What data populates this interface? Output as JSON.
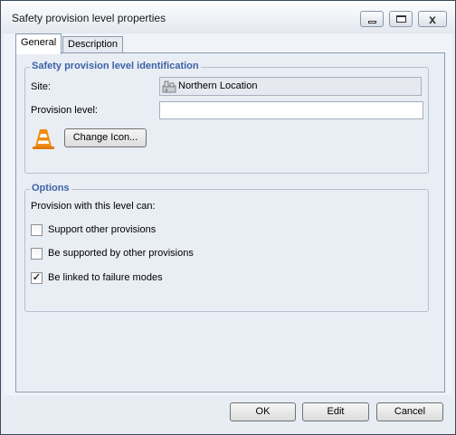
{
  "window": {
    "title": "Safety provision level properties",
    "controls": {
      "minimize": "minimize-icon",
      "maximize": "maximize-icon",
      "close": "close-icon",
      "close_glyph": "x"
    }
  },
  "tabs": [
    {
      "label": "General",
      "selected": true
    },
    {
      "label": "Description",
      "selected": false
    }
  ],
  "identification": {
    "group_title": "Safety provision level identification",
    "site_label": "Site:",
    "site_value": "Northern Location",
    "site_icon": "location-building-icon",
    "provision_level_label": "Provision level:",
    "provision_level_value": "",
    "icon": "traffic-cone-icon",
    "change_icon_label": "Change Icon..."
  },
  "options": {
    "group_title": "Options",
    "intro": "Provision with this level can:",
    "checkboxes": [
      {
        "label": "Support other provisions",
        "checked": false
      },
      {
        "label": "Be supported by other provisions",
        "checked": false
      },
      {
        "label": "Be linked to failure modes",
        "checked": true
      }
    ]
  },
  "footer": {
    "ok_label": "OK",
    "edit_label": "Edit",
    "cancel_label": "Cancel"
  },
  "colors": {
    "group_title": "#3d62a5",
    "panel_background": "#e9eef5"
  }
}
